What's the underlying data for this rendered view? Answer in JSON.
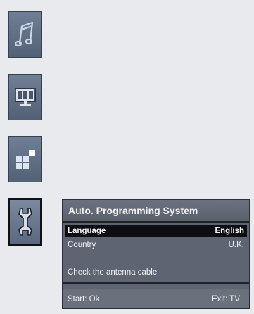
{
  "sidebar": {
    "items": [
      {
        "icon": "music-note-icon"
      },
      {
        "icon": "monitor-picture-icon"
      },
      {
        "icon": "feature-squares-icon"
      },
      {
        "icon": "wrench-install-icon"
      }
    ]
  },
  "dialog": {
    "title": "Auto. Programming System",
    "rows": [
      {
        "label": "Language",
        "value": "English"
      },
      {
        "label": "Country",
        "value": "U.K."
      }
    ],
    "message": "Check the antenna cable",
    "start_label": "Start: Ok",
    "exit_label": "Exit: TV"
  },
  "colors": {
    "background": "#e8eaee",
    "tile": "#5f6c82",
    "panel": "#5e6471",
    "selected_row": "#0d0e10"
  }
}
